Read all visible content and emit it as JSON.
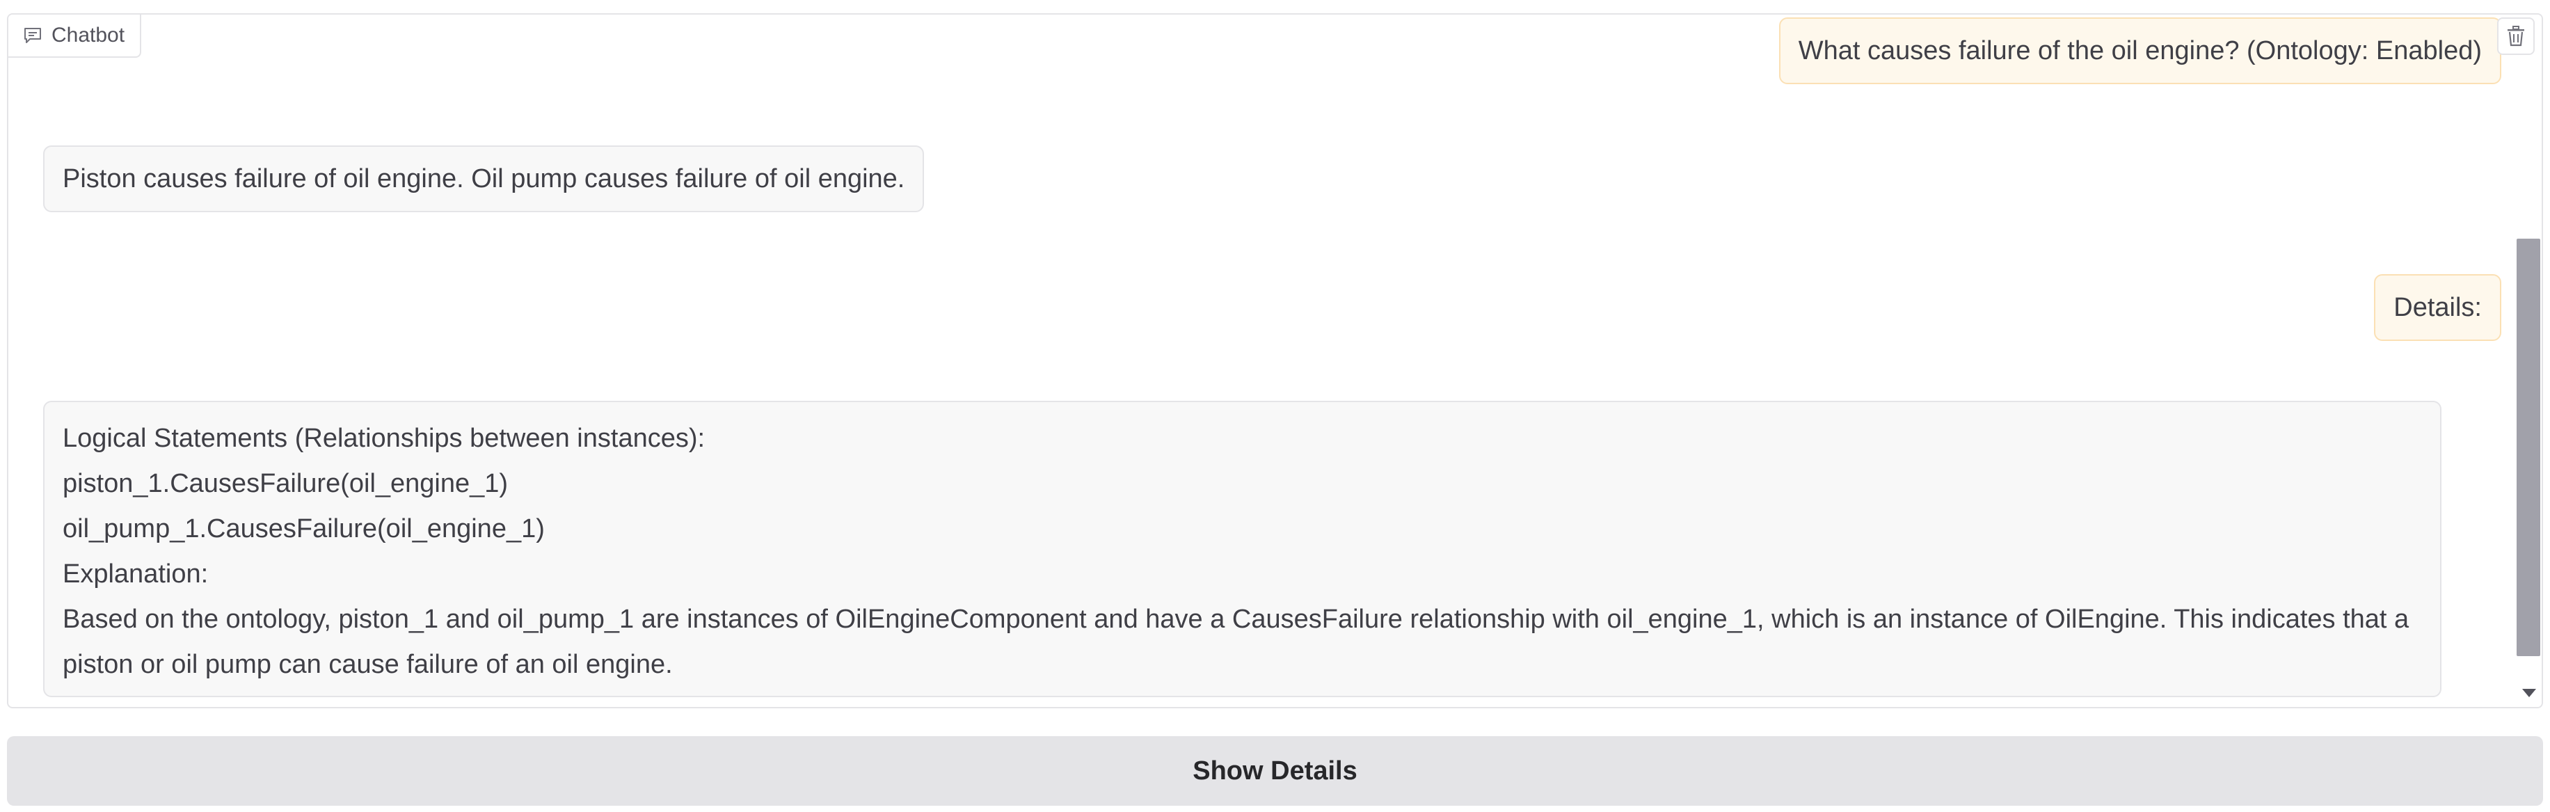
{
  "chatbot": {
    "label": "Chatbot",
    "messages": [
      {
        "role": "user",
        "text": "What causes failure of the oil engine? (Ontology: Enabled)"
      },
      {
        "role": "assistant",
        "text": "Piston causes failure of oil engine. Oil pump causes failure of oil engine."
      },
      {
        "role": "user",
        "text": "Details:"
      },
      {
        "role": "assistant",
        "lines": [
          "Logical Statements (Relationships between instances):",
          "piston_1.CausesFailure(oil_engine_1)",
          "oil_pump_1.CausesFailure(oil_engine_1)",
          "Explanation:",
          "Based on the ontology, piston_1 and oil_pump_1 are instances of OilEngineComponent and have a CausesFailure relationship with oil_engine_1, which is an instance of OilEngine. This indicates that a piston or oil pump can cause failure of an oil engine."
        ]
      }
    ]
  },
  "show_details_button": "Show Details",
  "icons": {
    "chat": "chat-bubble-icon",
    "clear": "trash-icon"
  },
  "colors": {
    "user_bubble_bg": "#fef8ec",
    "user_bubble_border": "#fbe0b4",
    "bot_bubble_bg": "#f8f8f8",
    "button_bg": "#e4e4e7"
  }
}
